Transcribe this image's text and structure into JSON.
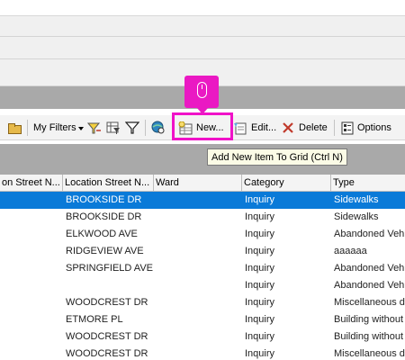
{
  "toolbar": {
    "my_filters_label": "My Filters",
    "new_label": "New...",
    "edit_label": "Edit...",
    "delete_label": "Delete",
    "options_label": "Options"
  },
  "tooltip": {
    "text": "Add New Item To Grid (Ctrl N)"
  },
  "grid": {
    "columns": [
      "on Street N...",
      "Location Street N...",
      "Ward",
      "Category",
      "Type"
    ],
    "rows": [
      {
        "street": "BROOKSIDE DR",
        "ward": "",
        "category": "Inquiry",
        "type": "Sidewalks",
        "selected": true
      },
      {
        "street": "BROOKSIDE DR",
        "ward": "",
        "category": "Inquiry",
        "type": "Sidewalks",
        "selected": false
      },
      {
        "street": "ELKWOOD AVE",
        "ward": "",
        "category": "Inquiry",
        "type": "Abandoned Vehi",
        "selected": false
      },
      {
        "street": "RIDGEVIEW AVE",
        "ward": "",
        "category": "Inquiry",
        "type": "aaaaaa",
        "selected": false
      },
      {
        "street": "SPRINGFIELD AVE",
        "ward": "",
        "category": "Inquiry",
        "type": "Abandoned Vehi",
        "selected": false
      },
      {
        "street": "",
        "ward": "",
        "category": "Inquiry",
        "type": "Abandoned Vehi",
        "selected": false
      },
      {
        "street": "WOODCREST DR",
        "ward": "",
        "category": "Inquiry",
        "type": "Miscellaneous d",
        "selected": false
      },
      {
        "street": "ETMORE PL",
        "ward": "",
        "category": "Inquiry",
        "type": "Building without",
        "selected": false
      },
      {
        "street": "WOODCREST DR",
        "ward": "",
        "category": "Inquiry",
        "type": "Building without",
        "selected": false
      },
      {
        "street": "WOODCREST DR",
        "ward": "",
        "category": "Inquiry",
        "type": "Miscellaneous d",
        "selected": false
      }
    ]
  },
  "colors": {
    "selected_row": "#0a7ad8",
    "highlight": "#f012c8",
    "tooltip_bg": "#fbfbe6"
  }
}
